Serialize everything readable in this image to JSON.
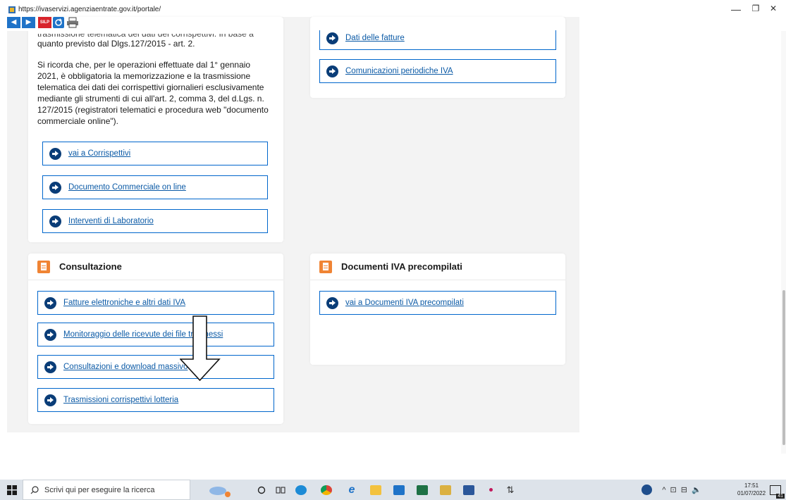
{
  "browser": {
    "url": "https://ivaservizi.agenziaentrate.gov.it/portale/",
    "minimize_glyph": "—",
    "maximize_glyph": "❐",
    "close_glyph": "✕"
  },
  "toolbar": {
    "back_label": "◀",
    "forward_label": "▶",
    "silp_label": "SILP"
  },
  "corrispettivi_card": {
    "paragraph_1_partial": "trasmissione telematica dei dati dei corrispettivi. In base a",
    "paragraph_1_end": "quanto previsto dal Dlgs.127/2015 - art. 2.",
    "paragraph_2": "Si ricorda che, per le operazioni effettuate dal 1° gennaio 2021, è obbligatoria la memorizzazione e la trasmissione telematica dei dati dei corrispettivi giornalieri esclusivamente mediante gli strumenti di cui all'art. 2, comma 3, del d.Lgs. n. 127/2015 (registratori telematici e procedura web \"documento commerciale online\").",
    "links": [
      "vai a Corrispettivi",
      "Documento Commerciale on line",
      "Interventi di Laboratorio"
    ]
  },
  "fatture_card": {
    "links": [
      "Dati delle fatture",
      "Comunicazioni periodiche IVA"
    ]
  },
  "consultazione_card": {
    "title": "Consultazione",
    "links": [
      "Fatture elettroniche e altri dati IVA",
      "Monitoraggio delle ricevute dei file trasmessi",
      "Consultazioni e download massivo",
      "Trasmissioni corrispettivi lotteria"
    ]
  },
  "precompilati_card": {
    "title": "Documenti IVA precompilati",
    "links": [
      "vai a Documenti IVA precompilati"
    ]
  },
  "taskbar": {
    "search_placeholder": "Scrivi qui per eseguire la ricerca",
    "time": "17:51",
    "date": "01/07/2022",
    "notification_count": "41"
  },
  "colors": {
    "accent_orange": "#f08434",
    "link_blue": "#0b5aa6",
    "box_border": "#0066cc",
    "arrow_bg": "#0a3d78"
  }
}
